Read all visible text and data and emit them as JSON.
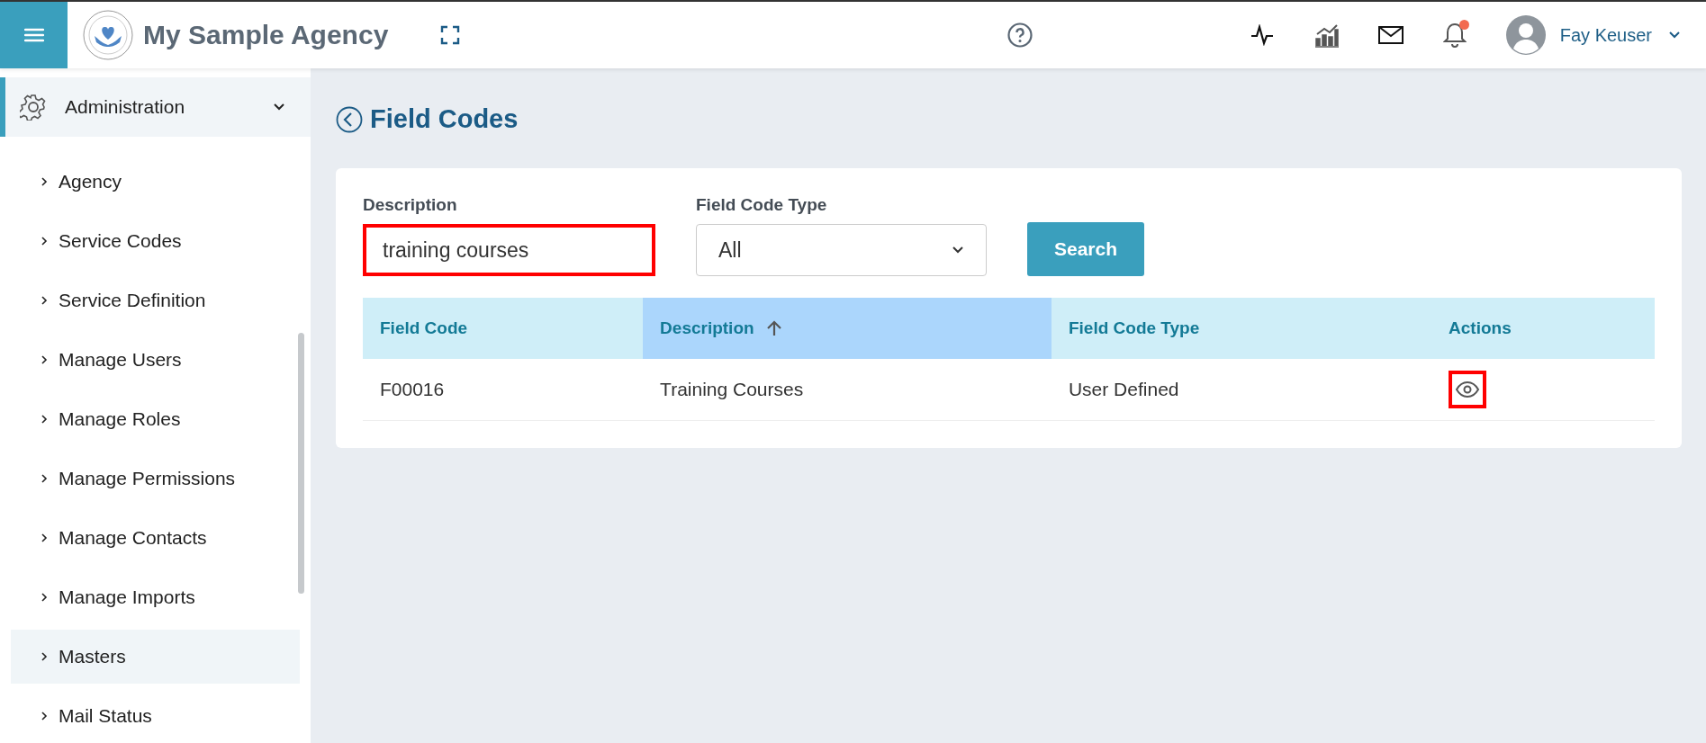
{
  "header": {
    "brand": "My Sample Agency",
    "user": {
      "name": "Fay Keuser"
    },
    "notifications": {
      "unread": true
    }
  },
  "sidebar": {
    "section": {
      "label": "Administration",
      "expanded": true
    },
    "items": [
      {
        "label": "Agency",
        "selected": false
      },
      {
        "label": "Service Codes",
        "selected": false
      },
      {
        "label": "Service Definition",
        "selected": false
      },
      {
        "label": "Manage Users",
        "selected": false
      },
      {
        "label": "Manage Roles",
        "selected": false
      },
      {
        "label": "Manage Permissions",
        "selected": false
      },
      {
        "label": "Manage Contacts",
        "selected": false
      },
      {
        "label": "Manage Imports",
        "selected": false
      },
      {
        "label": "Masters",
        "selected": true
      },
      {
        "label": "Mail Status",
        "selected": false
      }
    ]
  },
  "page": {
    "title": "Field Codes"
  },
  "filters": {
    "description": {
      "label": "Description",
      "value": "training courses",
      "highlighted": true
    },
    "field_code_type": {
      "label": "Field Code Type",
      "value": "All"
    },
    "search_button": "Search"
  },
  "table": {
    "columns": [
      {
        "label": "Field Code",
        "sorted": false
      },
      {
        "label": "Description",
        "sorted": true
      },
      {
        "label": "Field Code Type",
        "sorted": false
      },
      {
        "label": "Actions",
        "sorted": false
      }
    ],
    "rows": [
      {
        "cells": [
          "F00016",
          "Training Courses",
          "User Defined"
        ],
        "view_highlighted": true
      }
    ]
  }
}
